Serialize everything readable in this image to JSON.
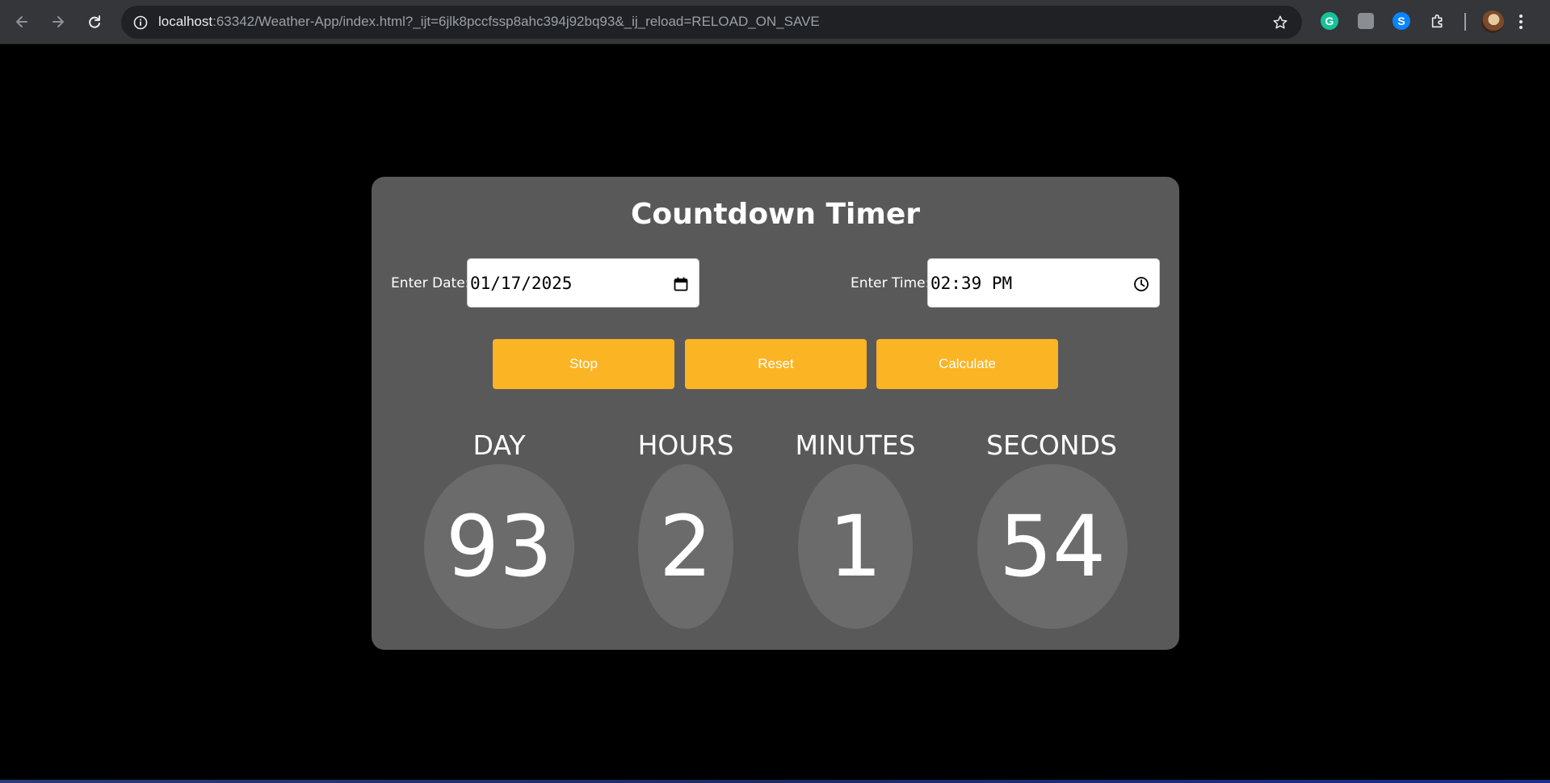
{
  "browser": {
    "url_host": "localhost",
    "url_rest": ":63342/Weather-App/index.html?_ijt=6jlk8pccfssp8ahc394j92bq93&_ij_reload=RELOAD_ON_SAVE",
    "icons": [
      "back-icon",
      "forward-icon",
      "reload-icon",
      "site-info-icon",
      "bookmark-star-icon",
      "grammarly-icon",
      "extension-icon",
      "shazam-icon",
      "extensions-puzzle-icon",
      "profile-avatar",
      "kebab-menu-icon"
    ]
  },
  "timer": {
    "title": "Countdown Timer",
    "date_label": "Enter Date:",
    "date_value": "01/17/2025",
    "time_label": "Enter Time:",
    "time_value": "02:39 PM",
    "buttons": {
      "stop": "Stop",
      "reset": "Reset",
      "calculate": "Calculate"
    },
    "units": [
      {
        "label": "DAY",
        "value": "93"
      },
      {
        "label": "HOURS",
        "value": "2"
      },
      {
        "label": "MINUTES",
        "value": "1"
      },
      {
        "label": "SECONDS",
        "value": "54"
      }
    ]
  },
  "colors": {
    "accent": "#fbb424",
    "card": "#595959",
    "bubble": "#6b6b6b",
    "page_background": "#000000"
  }
}
